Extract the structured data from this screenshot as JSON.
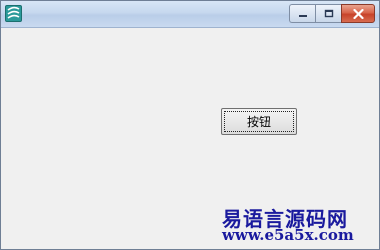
{
  "window": {
    "title": "",
    "controls": {
      "minimize_icon": "minimize-icon",
      "maximize_icon": "maximize-icon",
      "close_icon": "close-icon"
    }
  },
  "client": {
    "button_label": "按钮"
  },
  "watermark": {
    "title": "易语言源码网",
    "url": "www.e5a5x.com"
  }
}
